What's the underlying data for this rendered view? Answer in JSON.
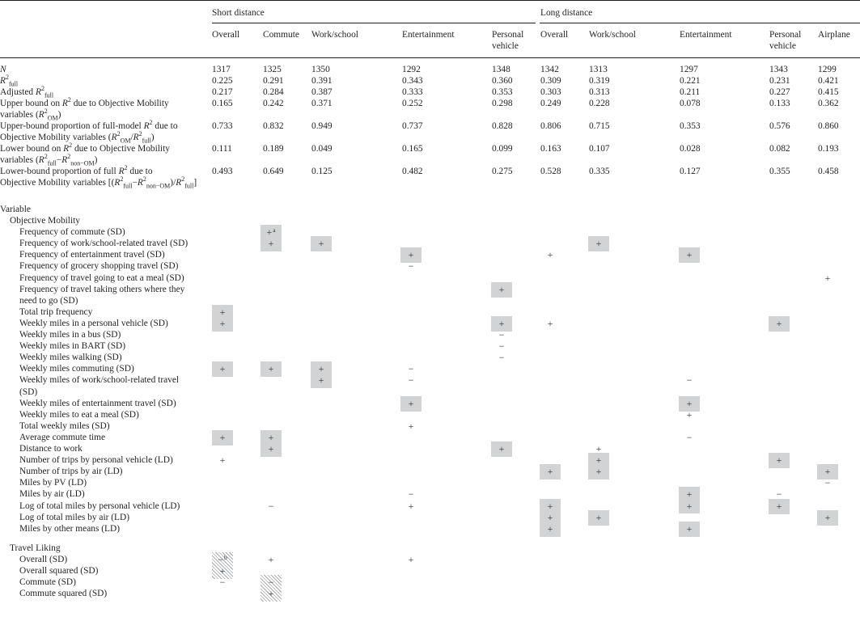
{
  "table": {
    "group_headers": [
      "Short distance",
      "Long distance"
    ],
    "columns": [
      {
        "group": "Short distance",
        "label": "Overall"
      },
      {
        "group": "Short distance",
        "label": "Commute"
      },
      {
        "group": "Short distance",
        "label": "Work/school"
      },
      {
        "group": "Short distance",
        "label": "Entertainment"
      },
      {
        "group": "Short distance",
        "label": "Personal vehicle"
      },
      {
        "group": "Long distance",
        "label": "Overall"
      },
      {
        "group": "Long distance",
        "label": "Work/school"
      },
      {
        "group": "Long distance",
        "label": "Entertainment"
      },
      {
        "group": "Long distance",
        "label": "Personal vehicle"
      },
      {
        "group": "Long distance",
        "label": "Airplane"
      }
    ],
    "col_labels_line1": [
      "Overall",
      "Commute",
      "Work/school",
      "Entertainment",
      "Personal",
      "Overall",
      "Work/school",
      "Entertainment",
      "Personal",
      "Airplane"
    ],
    "col_labels_line2": [
      "",
      "",
      "",
      "",
      "vehicle",
      "",
      "",
      "",
      "vehicle",
      ""
    ],
    "stats_rows": [
      {
        "label_lines": [
          "N"
        ],
        "values": [
          "1317",
          "1325",
          "1350",
          "1292",
          "1348",
          "1342",
          "1313",
          "1297",
          "1343",
          "1299"
        ]
      },
      {
        "label_lines": [
          "R²full"
        ],
        "values": [
          "0.225",
          "0.291",
          "0.391",
          "0.343",
          "0.360",
          "0.309",
          "0.319",
          "0.221",
          "0.231",
          "0.421"
        ]
      },
      {
        "label_lines": [
          "Adjusted R²full"
        ],
        "values": [
          "0.217",
          "0.284",
          "0.387",
          "0.333",
          "0.353",
          "0.303",
          "0.313",
          "0.211",
          "0.227",
          "0.415"
        ]
      },
      {
        "label_lines": [
          "Upper bound on R² due to Objective Mobility",
          "variables (R²OM)"
        ],
        "values": [
          "0.165",
          "0.242",
          "0.371",
          "0.252",
          "0.298",
          "0.249",
          "0.228",
          "0.078",
          "0.133",
          "0.362"
        ]
      },
      {
        "label_lines": [
          "Upper-bound proportion of full-model R² due to",
          "Objective Mobility variables (R²OM/R²full)"
        ],
        "values": [
          "0.733",
          "0.832",
          "0.949",
          "0.737",
          "0.828",
          "0.806",
          "0.715",
          "0.353",
          "0.576",
          "0.860"
        ]
      },
      {
        "label_lines": [
          "Lower bound on R² due to Objective Mobility",
          "variables (R²full−R²non−OM)"
        ],
        "values": [
          "0.111",
          "0.189",
          "0.049",
          "0.165",
          "0.099",
          "0.163",
          "0.107",
          "0.028",
          "0.082",
          "0.193"
        ]
      },
      {
        "label_lines": [
          "Lower-bound proportion of full R² due to",
          "Objective Mobility variables [(R²full−R²non−OM)/R²full]"
        ],
        "values": [
          "0.493",
          "0.649",
          "0.125",
          "0.482",
          "0.275",
          "0.528",
          "0.335",
          "0.127",
          "0.355",
          "0.458"
        ]
      }
    ],
    "variable_header": "Variable",
    "sections": [
      {
        "title": "Objective Mobility",
        "rows": [
          {
            "label": "Frequency of commute (SD)",
            "signs": {
              "1": "+"
            },
            "footnote": {
              "1": "a"
            }
          },
          {
            "label": "Frequency of work/school-related travel (SD)",
            "signs": {
              "1": "+",
              "2": "+",
              "6": "+"
            }
          },
          {
            "label": "Frequency of entertainment travel (SD)",
            "signs": {
              "3": "+",
              "5": "+",
              "7": "+"
            }
          },
          {
            "label": "Frequency of grocery shopping travel (SD)",
            "signs": {
              "3": "−"
            }
          },
          {
            "label": "Frequency of travel going to eat a meal (SD)",
            "signs": {
              "9": "+"
            }
          },
          {
            "label": "Frequency of travel taking others where they",
            "label2": "need to go (SD)",
            "signs": {
              "4": "+"
            }
          },
          {
            "label": "Total trip frequency",
            "signs": {
              "0": "+"
            }
          },
          {
            "label": "Weekly miles in a personal vehicle (SD)",
            "signs": {
              "0": "+",
              "4": "+",
              "5": "+",
              "8": "+"
            }
          },
          {
            "label": "Weekly miles in a bus (SD)",
            "signs": {
              "4": "−"
            }
          },
          {
            "label": "Weekly miles in BART (SD)",
            "signs": {
              "4": "−"
            }
          },
          {
            "label": "Weekly miles walking (SD)",
            "signs": {
              "4": "−"
            }
          },
          {
            "label": "Weekly miles commuting (SD)",
            "signs": {
              "0": "+",
              "1": "+",
              "2": "+",
              "3": "−"
            }
          },
          {
            "label": "Weekly miles of work/school-related travel",
            "label2": "(SD)",
            "signs": {
              "2": "+",
              "3": "−",
              "7": "−"
            }
          },
          {
            "label": "Weekly miles of entertainment travel (SD)",
            "signs": {
              "3": "+",
              "7": "+"
            }
          },
          {
            "label": "Weekly miles to eat a meal (SD)",
            "signs": {
              "7": "+"
            }
          },
          {
            "label": "Total weekly miles (SD)",
            "signs": {
              "3": "+"
            }
          },
          {
            "label": "Average commute time",
            "signs": {
              "0": "+",
              "1": "+",
              "7": "−"
            }
          },
          {
            "label": "Distance to work",
            "signs": {
              "1": "+",
              "4": "+",
              "6": "+"
            }
          },
          {
            "label": "Number of trips by personal vehicle (LD)",
            "signs": {
              "0": "+",
              "6": "+",
              "8": "+"
            }
          },
          {
            "label": "Number of trips by air (LD)",
            "signs": {
              "5": "+",
              "6": "+",
              "9": "+"
            }
          },
          {
            "label": "Miles by PV (LD)",
            "signs": {
              "9": "−"
            }
          },
          {
            "label": "Miles by air (LD)",
            "signs": {
              "3": "−",
              "7": "+",
              "8": "−"
            }
          },
          {
            "label": "Log of total miles by personal vehicle (LD)",
            "signs": {
              "1": "−",
              "3": "+",
              "5": "+",
              "7": "+",
              "8": "+"
            }
          },
          {
            "label": "Log of total miles by air (LD)",
            "signs": {
              "5": "+",
              "6": "+",
              "9": "+"
            }
          },
          {
            "label": "Miles by other means (LD)",
            "signs": {
              "5": "+",
              "7": "+"
            }
          }
        ]
      },
      {
        "title": "Travel Liking",
        "rows": [
          {
            "label": "Overall (SD)",
            "signs": {
              "0": "−",
              "1": "+",
              "3": "+"
            },
            "footnote": {
              "0": "b"
            }
          },
          {
            "label": "Overall squared (SD)",
            "signs": {
              "0": "+"
            }
          },
          {
            "label": "Commute (SD)",
            "signs": {
              "0": "−",
              "1": "−"
            }
          },
          {
            "label": "Commute squared (SD)",
            "signs": {
              "1": "+"
            }
          }
        ]
      }
    ],
    "shading": {
      "gray_highlight": "#d2d3d5",
      "hatch": "#a7a9ac"
    }
  }
}
